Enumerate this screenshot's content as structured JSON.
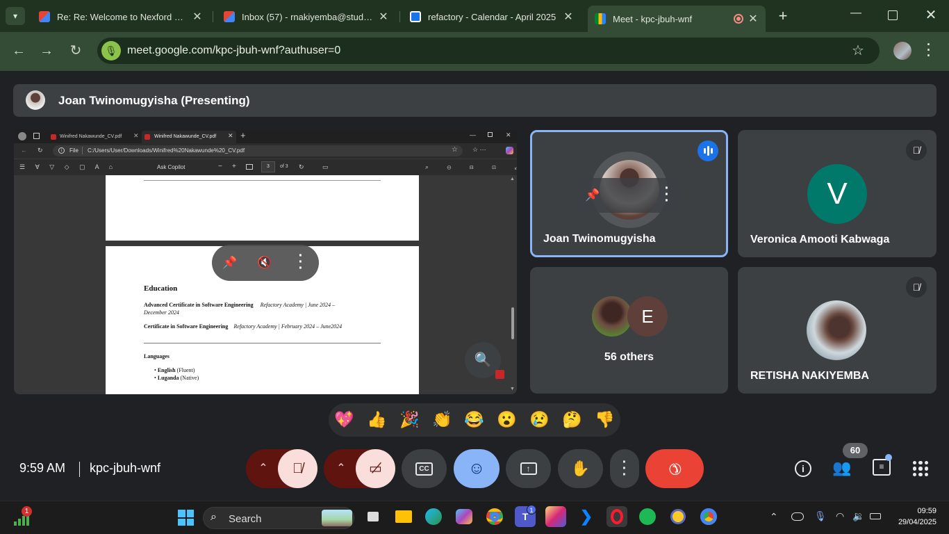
{
  "browser": {
    "tabs": [
      {
        "title": "Re: Re: Welcome to Nexford Univer",
        "icon": "gmail-icon"
      },
      {
        "title": "Inbox (57) - rnakiyemba@student.n",
        "icon": "gmail-icon"
      },
      {
        "title": "refactory - Calendar - April 2025",
        "icon": "calendar-icon"
      },
      {
        "title": "Meet - kpc-jbuh-wnf",
        "icon": "meet-icon",
        "active": true
      }
    ],
    "url": "meet.google.com/kpc-jbuh-wnf?authuser=0"
  },
  "presenter_bar": {
    "label": "Joan Twinomugyisha (Presenting)"
  },
  "shared_screen": {
    "edge_tabs": [
      "Winifred Nakawunde_CV.pdf",
      "Winifred Nakawunde_CV.pdf"
    ],
    "file_label": "File",
    "file_path": "C:/Users/User/Downloads/Winifred%20Nakawunde%20_CV.pdf",
    "ask_copilot": "Ask Copilot",
    "page_current": "3",
    "page_total": "of 3",
    "doc": {
      "education_heading": "Education",
      "cert1_name": "Advanced Certificate in Software Engineering",
      "cert1_detail": "Refactory Academy | June 2024 –",
      "cert1_detail2": "December 2024",
      "cert2_name": "Certificate in Software Engineering",
      "cert2_detail": "Refactory Academy | February 2024 – June2024",
      "languages_heading": "Languages",
      "lang1_name": "English",
      "lang1_level": "(Fluent)",
      "lang2_name": "Luganda",
      "lang2_level": "(Native)"
    }
  },
  "participants": [
    {
      "name": "Joan Twinomugyisha",
      "speaking": true
    },
    {
      "name": "Veronica Amooti Kabwaga",
      "initial": "V",
      "muted": true,
      "color": "#00796b"
    },
    {
      "name": "56 others",
      "initial": "E"
    },
    {
      "name": "RETISHA NAKIYEMBA",
      "muted": true
    }
  ],
  "reactions": [
    "💖",
    "👍",
    "🎉",
    "👏",
    "😂",
    "😮",
    "😢",
    "🤔",
    "👎"
  ],
  "meeting": {
    "time": "9:59 AM",
    "code": "kpc-jbuh-wnf",
    "participant_count": "60"
  },
  "taskbar": {
    "search_label": "Search",
    "clock_time": "09:59",
    "clock_date": "29/04/2025",
    "notif_badge": "1",
    "teams_badge": "1"
  },
  "colors": {
    "accent_blue": "#8ab4f8",
    "end_call_red": "#ea4335",
    "muted_pink": "#f9dedc",
    "muted_dark": "#601410"
  }
}
